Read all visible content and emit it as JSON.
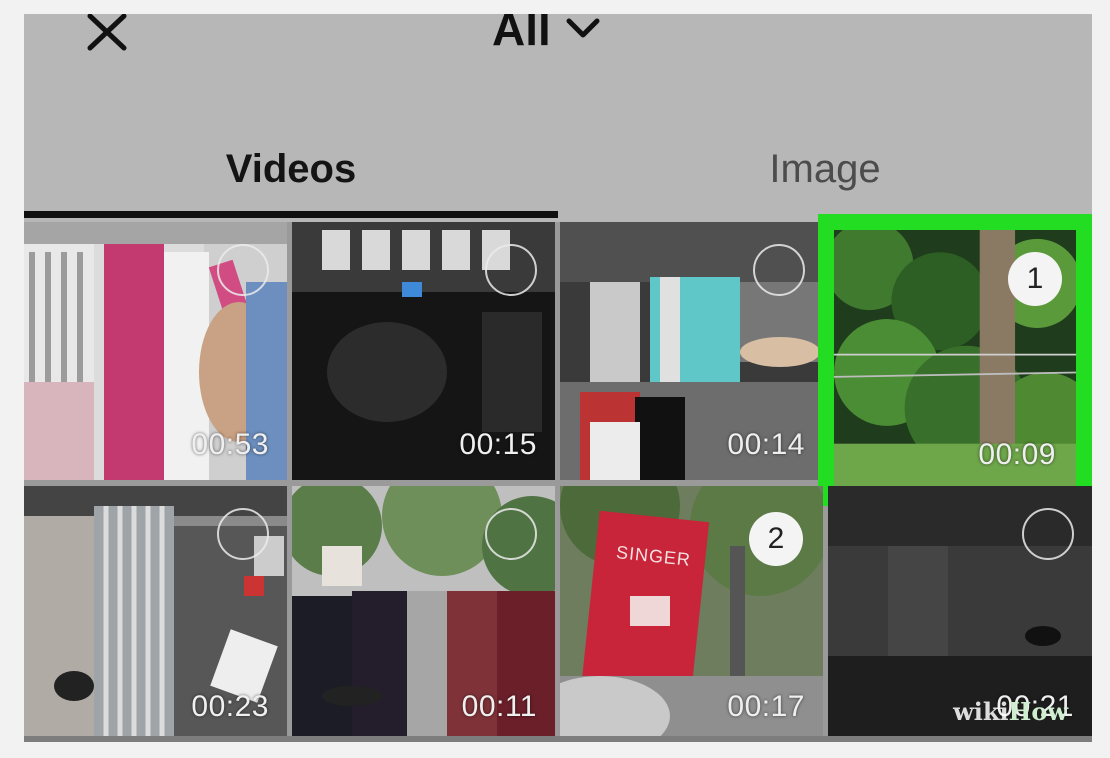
{
  "header": {
    "album_label": "All"
  },
  "icons": {
    "close": "close-icon",
    "dropdown": "chevron-down-icon"
  },
  "tabs": [
    {
      "label": "Videos",
      "active": true
    },
    {
      "label": "Image",
      "active": false
    }
  ],
  "videos": [
    {
      "duration": "00:53",
      "selected": false,
      "order": ""
    },
    {
      "duration": "00:15",
      "selected": false,
      "order": ""
    },
    {
      "duration": "00:14",
      "selected": false,
      "order": ""
    },
    {
      "duration": "00:09",
      "selected": true,
      "order": "1"
    },
    {
      "duration": "00:23",
      "selected": false,
      "order": ""
    },
    {
      "duration": "00:11",
      "selected": false,
      "order": ""
    },
    {
      "duration": "00:17",
      "selected": true,
      "order": "2"
    },
    {
      "duration": "00:21",
      "selected": false,
      "order": ""
    }
  ],
  "thumbnail_texts": {
    "singer_sign": "SINGER"
  },
  "watermark": {
    "prefix": "wiki",
    "suffix": "How"
  },
  "colors": {
    "highlight": "#22dd22",
    "overlay": "#b7b7b7"
  }
}
